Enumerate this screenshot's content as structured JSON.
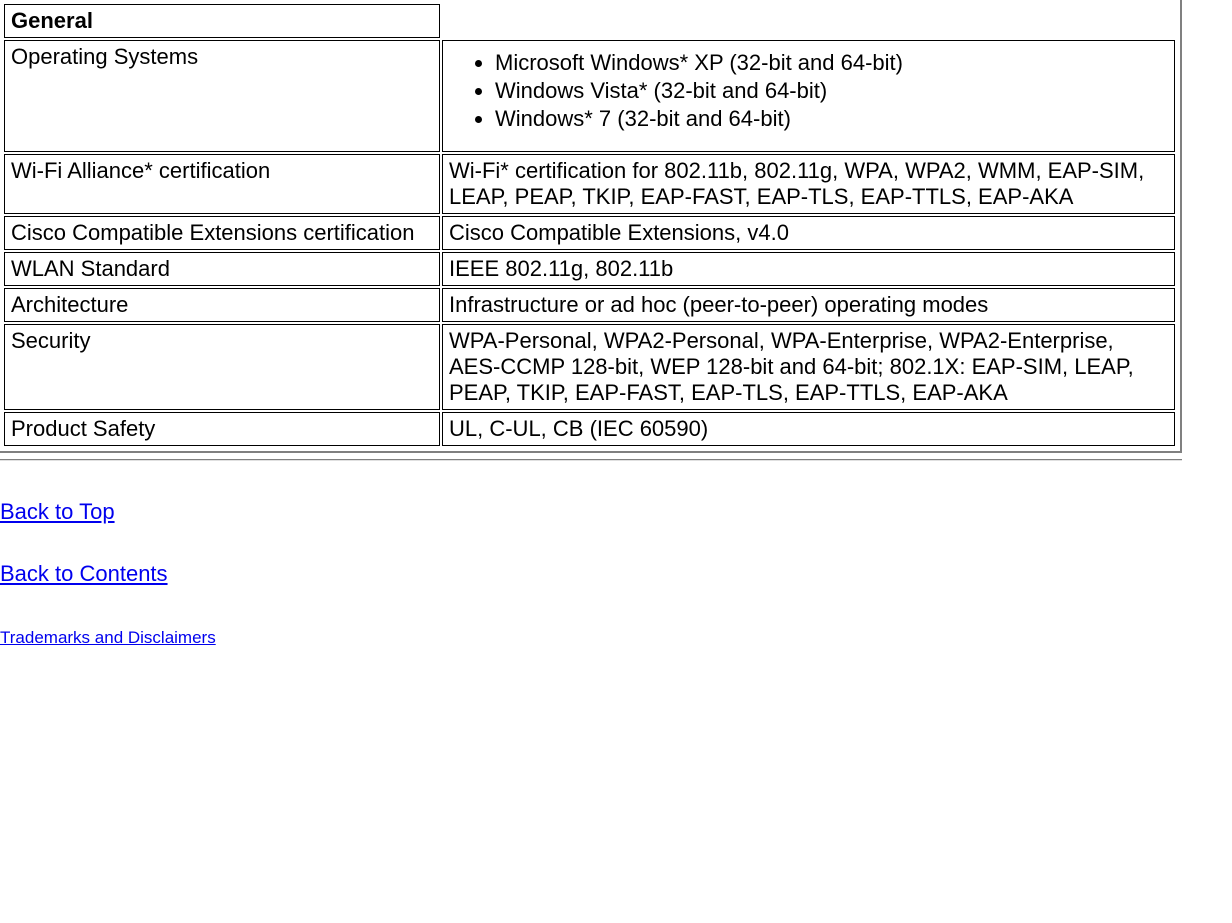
{
  "table": {
    "header": "General",
    "rows": [
      {
        "label": "Operating Systems",
        "list": [
          "Microsoft Windows* XP (32-bit and 64-bit)",
          "Windows Vista* (32-bit and 64-bit)",
          "Windows* 7 (32-bit and 64-bit)"
        ]
      },
      {
        "label": "Wi-Fi Alliance* certification",
        "value": "Wi-Fi* certification for 802.11b, 802.11g, WPA, WPA2, WMM, EAP-SIM, LEAP, PEAP, TKIP, EAP-FAST, EAP-TLS, EAP-TTLS, EAP-AKA"
      },
      {
        "label": "Cisco Compatible Extensions certification",
        "value": "Cisco Compatible Extensions, v4.0"
      },
      {
        "label": "WLAN Standard",
        "value": "IEEE 802.11g, 802.11b"
      },
      {
        "label": "Architecture",
        "value": "Infrastructure or ad hoc (peer-to-peer) operating modes"
      },
      {
        "label": "Security",
        "value": "WPA-Personal, WPA2-Personal, WPA-Enterprise, WPA2-Enterprise, AES-CCMP 128-bit, WEP 128-bit and 64-bit; 802.1X: EAP-SIM, LEAP, PEAP, TKIP, EAP-FAST, EAP-TLS, EAP-TTLS, EAP-AKA"
      },
      {
        "label": "Product Safety",
        "value": "UL, C-UL, CB (IEC 60590)"
      }
    ]
  },
  "links": {
    "back_to_top": "Back to Top",
    "back_to_contents": "Back to Contents",
    "trademarks": "Trademarks and Disclaimers"
  }
}
